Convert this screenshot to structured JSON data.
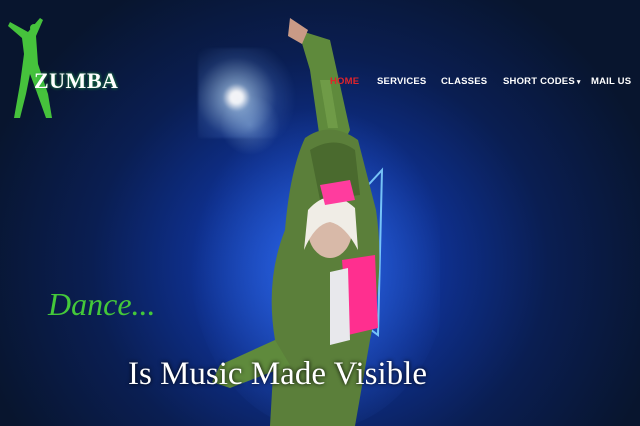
{
  "brand": {
    "name": "ZUMBA",
    "logo_icon": "dancer-silhouette-icon",
    "logo_color": "#46c23c"
  },
  "nav": {
    "items": [
      {
        "label": "HOME",
        "active": true
      },
      {
        "label": "SERVICES",
        "active": false
      },
      {
        "label": "CLASSES",
        "active": false
      },
      {
        "label": "SHORT CODES",
        "active": false,
        "has_dropdown": true,
        "dropdown_icon": "caret-down-icon"
      },
      {
        "label": "MAIL US",
        "active": false
      }
    ],
    "caret": "▾",
    "active_color": "#e0242a"
  },
  "hero": {
    "headline_1": "Dance...",
    "headline_2": "Is Music Made Visible",
    "headline_1_color": "#44c83a",
    "background_color": "#0a1e52",
    "image": "dancer-hero-image"
  }
}
